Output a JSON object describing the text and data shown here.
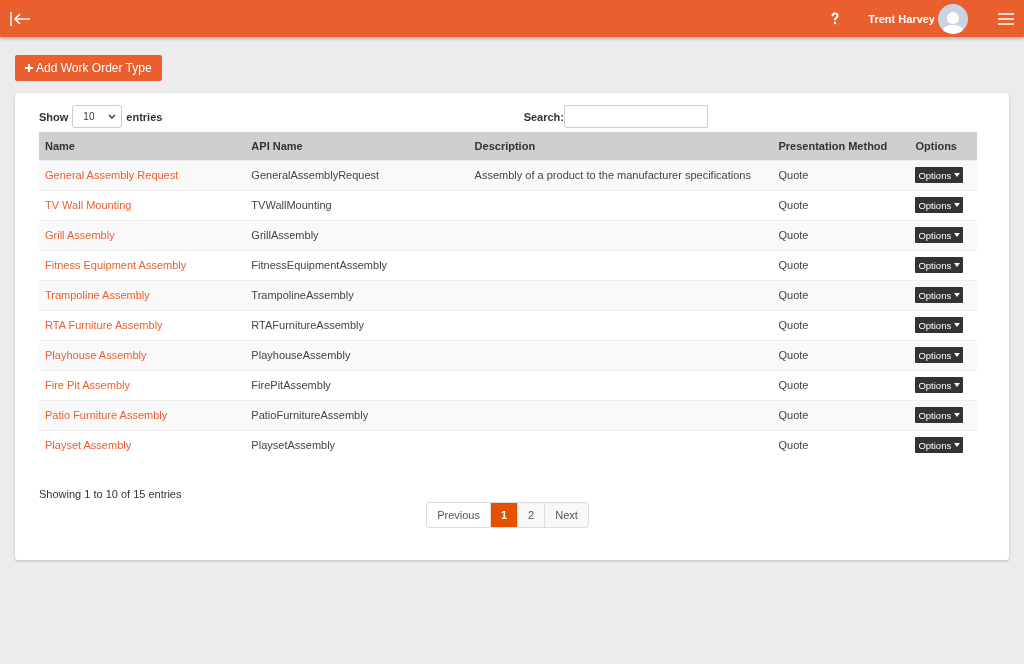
{
  "header": {
    "user_name": "Trent Harvey"
  },
  "add_button": {
    "label": "Add Work Order Type"
  },
  "table_controls": {
    "show_label": "Show",
    "page_size": "10",
    "entries_label": "entries",
    "search_label": "Search:"
  },
  "table": {
    "columns": [
      "Name",
      "API Name",
      "Description",
      "Presentation Method",
      "Options"
    ],
    "rows": [
      {
        "name": "General Assembly Request",
        "api_name": "GeneralAssemblyRequest",
        "description": "Assembly of a product to the manufacturer specifications",
        "presentation_method": "Quote",
        "options": "Options"
      },
      {
        "name": "TV Wall Mounting",
        "api_name": "TVWallMounting",
        "presentation_method": "Quote",
        "options": "Options"
      },
      {
        "name": "Grill Assembly",
        "api_name": "GrillAssembly",
        "presentation_method": "Quote",
        "options": "Options"
      },
      {
        "name": "Fitness Equipment Assembly",
        "api_name": "FitnessEquipmentAssembly",
        "presentation_method": "Quote",
        "options": "Options"
      },
      {
        "name": "Trampoline Assembly",
        "api_name": "TrampolineAssembly",
        "presentation_method": "Quote",
        "options": "Options"
      },
      {
        "name": "RTA Furniture Assembly",
        "api_name": "RTAFurnitureAssembly",
        "presentation_method": "Quote",
        "options": "Options"
      },
      {
        "name": "Playhouse Assembly",
        "api_name": "PlayhouseAssembly",
        "presentation_method": "Quote",
        "options": "Options"
      },
      {
        "name": "Fire Pit Assembly",
        "api_name": "FirePitAssembly",
        "presentation_method": "Quote",
        "options": "Options"
      },
      {
        "name": "Patio Furniture Assembly",
        "api_name": "PatioFurnitureAssembly",
        "presentation_method": "Quote",
        "options": "Options"
      },
      {
        "name": "Playset Assembly",
        "api_name": "PlaysetAssembly",
        "presentation_method": "Quote",
        "options": "Options"
      }
    ]
  },
  "table_info": "Showing 1 to 10 of 15 entries",
  "pagination": [
    {
      "label": "Previous",
      "selected": false
    },
    {
      "label": "1",
      "selected": true
    },
    {
      "label": "2",
      "selected": false
    },
    {
      "label": "Next",
      "selected": false
    }
  ]
}
